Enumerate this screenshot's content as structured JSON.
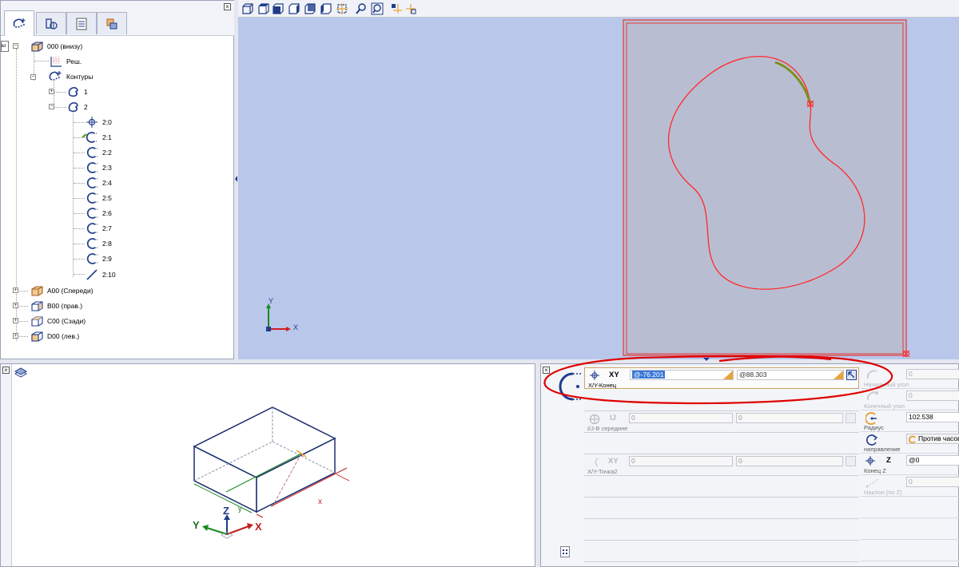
{
  "tree": {
    "tooltip_text": "ы",
    "items": [
      {
        "label": "000 (внизу)"
      },
      {
        "label": "Реш."
      },
      {
        "label": "Контуры"
      },
      {
        "label": "1"
      },
      {
        "label": "2"
      },
      {
        "label": "2:0"
      },
      {
        "label": "2:1"
      },
      {
        "label": "2:2"
      },
      {
        "label": "2:3"
      },
      {
        "label": "2:4"
      },
      {
        "label": "2:5"
      },
      {
        "label": "2:6"
      },
      {
        "label": "2:7"
      },
      {
        "label": "2:8"
      },
      {
        "label": "2:9"
      },
      {
        "label": "2:10"
      },
      {
        "label": "A00 (Спереди)"
      },
      {
        "label": "B00 (прав.)"
      },
      {
        "label": "C00 (Сзади)"
      },
      {
        "label": "D00 (лев.)"
      }
    ]
  },
  "viewport": {
    "axis_y": "Y",
    "axis_x": "X"
  },
  "iso": {
    "axis_z": "Z",
    "axis_y": "Y",
    "axis_x": "X",
    "dim_x": "x",
    "dim_y": "y"
  },
  "params": {
    "xy_end": {
      "code": "XY",
      "label": "X/Y-Конец",
      "x_value": "@-76.201",
      "y_value": "@88.303"
    },
    "ij_mid": {
      "code": "IJ",
      "label": "I/J-В середине",
      "i_value": "0",
      "j_value": "0"
    },
    "xy_point2": {
      "code": "XY",
      "label": "X/Y-Точка2",
      "x_value": "0",
      "y_value": "0"
    },
    "start_angle": {
      "label": "Начальный угол",
      "value": "0"
    },
    "end_angle": {
      "label": "Конечный угол",
      "value": "0"
    },
    "radius": {
      "label": "Радиус",
      "value": "102.538"
    },
    "direction": {
      "label": "направление",
      "value": "Против часов"
    },
    "end_z": {
      "code": "Z",
      "label": "Конец Z",
      "value": "@0"
    },
    "slope_z": {
      "label": "Наклон (по Z)",
      "value": "0"
    }
  },
  "colors": {
    "viewport_bg": "#b8c7ea",
    "contour": "#ff2a2a",
    "highlight": "#6aa020",
    "annotation": "#e00000",
    "accent_field": "#e8a43c"
  }
}
